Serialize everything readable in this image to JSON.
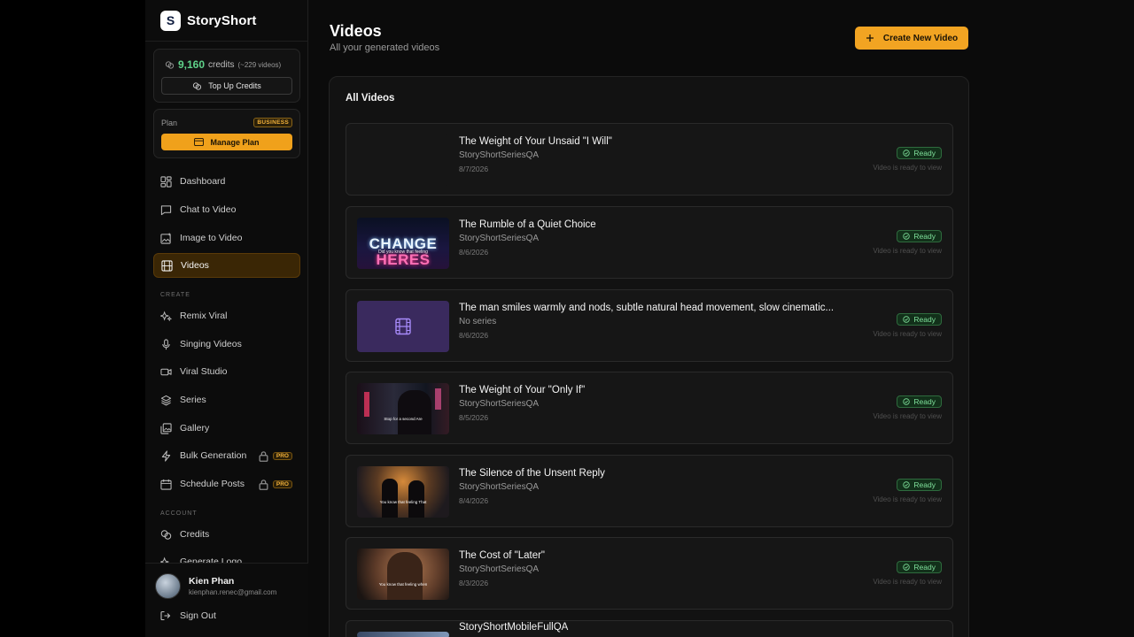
{
  "brand": {
    "logo_letter": "S",
    "name": "StoryShort"
  },
  "credits": {
    "amount": "9,160",
    "word": "credits",
    "approx": "(~229 videos)",
    "topup_label": "Top Up Credits"
  },
  "plan": {
    "label": "Plan",
    "badge": "BUSINESS",
    "manage_label": "Manage Plan"
  },
  "nav": {
    "main": [
      {
        "label": "Dashboard",
        "icon": "dashboard-icon"
      },
      {
        "label": "Chat to Video",
        "icon": "chat-icon"
      },
      {
        "label": "Image to Video",
        "icon": "image-icon"
      },
      {
        "label": "Videos",
        "icon": "film-icon",
        "active": true
      }
    ],
    "create_label": "CREATE",
    "create": [
      {
        "label": "Remix Viral",
        "icon": "sparkles-icon"
      },
      {
        "label": "Singing Videos",
        "icon": "mic-icon"
      },
      {
        "label": "Viral Studio",
        "icon": "video-camera-icon"
      },
      {
        "label": "Series",
        "icon": "layers-icon"
      },
      {
        "label": "Gallery",
        "icon": "gallery-icon"
      },
      {
        "label": "Bulk Generation",
        "icon": "bolt-icon",
        "badge": "PRO"
      },
      {
        "label": "Schedule Posts",
        "icon": "calendar-icon",
        "badge": "PRO"
      }
    ],
    "account_label": "ACCOUNT",
    "account": [
      {
        "label": "Credits",
        "icon": "coins-icon"
      },
      {
        "label": "Generate Logo",
        "icon": "sparkles-icon"
      }
    ]
  },
  "user": {
    "name": "Kien Phan",
    "email": "kienphan.renec@gmail.com",
    "signout_label": "Sign Out"
  },
  "page": {
    "title": "Videos",
    "subtitle": "All your generated videos",
    "create_label": "Create New Video"
  },
  "panel": {
    "title": "All Videos"
  },
  "videos": [
    {
      "title": "The Weight of Your Unsaid \"I Will\"",
      "series": "StoryShortSeriesQA",
      "date": "8/7/2026",
      "status": "Ready",
      "note": "Video is ready to view",
      "thumb": "empty"
    },
    {
      "title": "The Rumble of a Quiet Choice",
      "series": "StoryShortSeriesQA",
      "date": "8/6/2026",
      "status": "Ready",
      "note": "Video is ready to view",
      "thumb": "change",
      "thumb_text_top": "CHANGE",
      "thumb_text_bottom": "HERES",
      "thumb_caption": "Did you know that feeling"
    },
    {
      "title": "The man smiles warmly and nods, subtle natural head movement, slow cinematic...",
      "series": "No series",
      "date": "8/6/2026",
      "status": "Ready",
      "note": "Video is ready to view",
      "thumb": "film"
    },
    {
      "title": "The Weight of Your \"Only If\"",
      "series": "StoryShortSeriesQA",
      "date": "8/5/2026",
      "status": "Ready",
      "note": "Video is ready to view",
      "thumb": "city",
      "thumb_caption": "Stop for a second Are"
    },
    {
      "title": "The Silence of the Unsent Reply",
      "series": "StoryShortSeriesQA",
      "date": "8/4/2026",
      "status": "Ready",
      "note": "Video is ready to view",
      "thumb": "dusk",
      "thumb_caption": "You know that feeling That"
    },
    {
      "title": "The Cost of \"Later\"",
      "series": "StoryShortSeriesQA",
      "date": "8/3/2026",
      "status": "Ready",
      "note": "Video is ready to view",
      "thumb": "man",
      "thumb_caption": "You know that feeling when"
    },
    {
      "title": "StoryShortMobileFullQA",
      "series": "",
      "date": "",
      "status": "",
      "note": "",
      "thumb": "blue"
    }
  ],
  "colors": {
    "accent": "#f2a422",
    "ready_green": "#7fe09b",
    "credits_green": "#5fd38a",
    "pro_gold": "#f3b23b"
  }
}
